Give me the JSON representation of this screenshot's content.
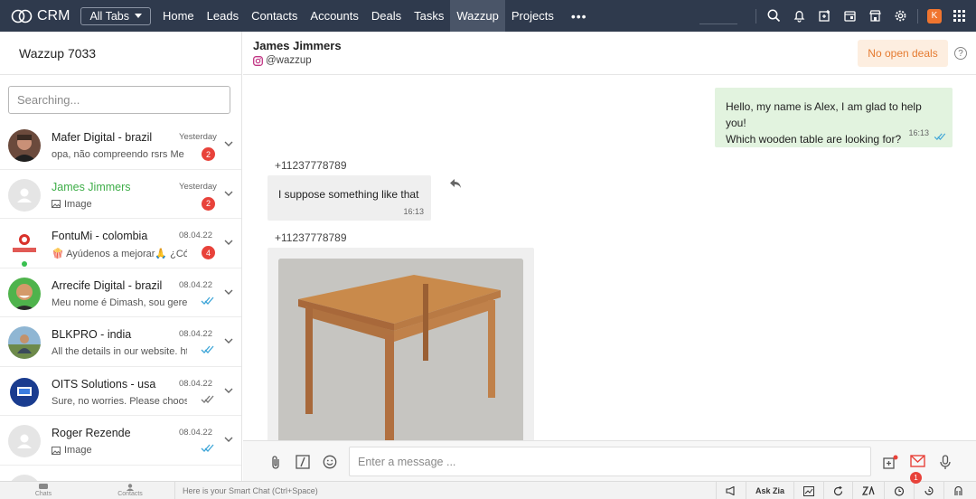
{
  "app": {
    "name": "CRM",
    "all_tabs_label": "All Tabs"
  },
  "nav": {
    "items": [
      {
        "label": "Home"
      },
      {
        "label": "Leads"
      },
      {
        "label": "Contacts"
      },
      {
        "label": "Accounts"
      },
      {
        "label": "Deals"
      },
      {
        "label": "Tasks"
      },
      {
        "label": "Wazzup",
        "active": true
      },
      {
        "label": "Projects"
      }
    ],
    "more_label": "•••",
    "avatar_initial": "K"
  },
  "left": {
    "title": "Wazzup 7033",
    "search_placeholder": "Searching...",
    "chats": [
      {
        "name": "Mafer Digital - brazil",
        "time": "Yesterday",
        "preview": "opa, não compreendo rsrs Me ...",
        "badge": "2",
        "avatar": "photo-man"
      },
      {
        "name": "James Jimmers",
        "time": "Yesterday",
        "preview": "Image",
        "preview_icon": "image-icon",
        "badge": "2",
        "avatar": "placeholder",
        "active": true
      },
      {
        "name": "FontuMi - colombia",
        "time": "08.04.22",
        "preview": "🍿 Ayúdenos a mejorar🙏 ¿Có...",
        "badge": "4",
        "avatar": "fontumi-logo",
        "online": true
      },
      {
        "name": "Arrecife Digital - brazil",
        "time": "08.04.22",
        "preview": "Meu nome é Dimash, sou gere...",
        "status": "read",
        "avatar": "photo-smile"
      },
      {
        "name": "BLKPRO - india",
        "time": "08.04.22",
        "preview": "All the details in our website. ht...",
        "status": "read",
        "avatar": "photo-outdoor"
      },
      {
        "name": "OITS Solutions - usa",
        "time": "08.04.22",
        "preview": "Sure, no worries. Please choos...",
        "status": "delivered",
        "avatar": "oits-logo"
      },
      {
        "name": "Roger Rezende",
        "time": "08.04.22",
        "preview": "Image",
        "preview_icon": "image-icon",
        "status": "read",
        "avatar": "placeholder"
      }
    ]
  },
  "chat": {
    "contact_name": "James Jimmers",
    "contact_handle": "@wazzup",
    "deals_button": "No open deals",
    "help_label": "?",
    "messages": {
      "outgoing": {
        "text_line1": "Hello, my name is Alex, I am glad to help you!",
        "text_line2": "Which wooden table are looking for?",
        "time": "16:13"
      },
      "incoming_sender_1": "+11237778789",
      "incoming_text": "I suppose something like that",
      "incoming_time": "16:13",
      "incoming_sender_2": "+11237778789"
    },
    "composer_placeholder": "Enter a message ...",
    "notification_count": "1"
  },
  "bottom": {
    "chats_label": "Chats",
    "contacts_label": "Contacts",
    "smart_chat": "Here is your Smart Chat (Ctrl+Space)",
    "ask_zia": "Ask Zia"
  },
  "colors": {
    "topbar": "#2f3a4d",
    "accent_green": "#3fae49",
    "badge_red": "#e8423a",
    "deals_orange": "#e57b31",
    "bubble_out": "#e2f3df"
  }
}
